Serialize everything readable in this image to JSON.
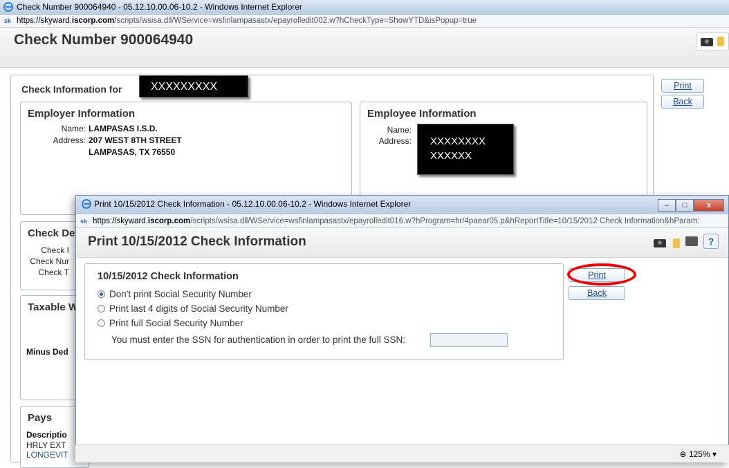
{
  "browser": {
    "title": "Check Number 900064940 - 05.12.10.00.06-10.2 - Windows Internet Explorer",
    "url_prefix": "https://skyward.",
    "url_domain": "iscorp.com",
    "url_rest": "/scripts/wsisa.dll/WService=wsfinlampasastx/epayrolledit002.w?hCheckType=ShowYTD&isPopup=true"
  },
  "main": {
    "title": "Check Number 900064940",
    "check_info_label": "Check Information for",
    "redacted_name": "XXXXXXXXX",
    "print_label": "Print",
    "back_label": "Back",
    "employer": {
      "heading": "Employer Information",
      "name_label": "Name:",
      "name": "LAMPASAS I.S.D.",
      "address_label": "Address:",
      "address1": "207 WEST 8TH STREET",
      "address2": "LAMPASAS, TX 76550"
    },
    "employee": {
      "heading": "Employee Information",
      "name_label": "Name:",
      "address_label": "Address:",
      "redacted1": "XXXXXXXX",
      "redacted2": "XXXXXX"
    },
    "partial": {
      "check_details": "Check De",
      "check_l1": "Check I",
      "check_l2": "Check Nur",
      "check_l3": "Check T",
      "taxable": "Taxable W",
      "minus": "Minus Ded",
      "pays": "Pays",
      "desc": "Descriptio",
      "row1": "HRLY EXT",
      "row2": "LONGEVIT"
    }
  },
  "popup": {
    "title": "Print 10/15/2012 Check Information - 05.12.10.00.06-10.2 - Windows Internet Explorer",
    "url_prefix": "https://skyward.",
    "url_domain": "iscorp.com",
    "url_rest": "/scripts/wsisa.dll/WService=wsfinlampasastx/epayrolledit016.w?hProgram=hr/4paear05.p&hReportTitle=10/15/2012 Check Information&hParam:",
    "heading": "Print 10/15/2012 Check Information",
    "section_title": "10/15/2012 Check Information",
    "options": [
      "Don't print Social Security Number",
      "Print last 4 digits of Social Security Number",
      "Print full Social Security Number"
    ],
    "ssn_prompt": "You must enter the SSN for authentication in order to print the full SSN:",
    "print_label": "Print",
    "back_label": "Back",
    "help_label": "?",
    "zoom": "125%",
    "win_min": "–",
    "win_max": "□",
    "win_close": "x"
  }
}
